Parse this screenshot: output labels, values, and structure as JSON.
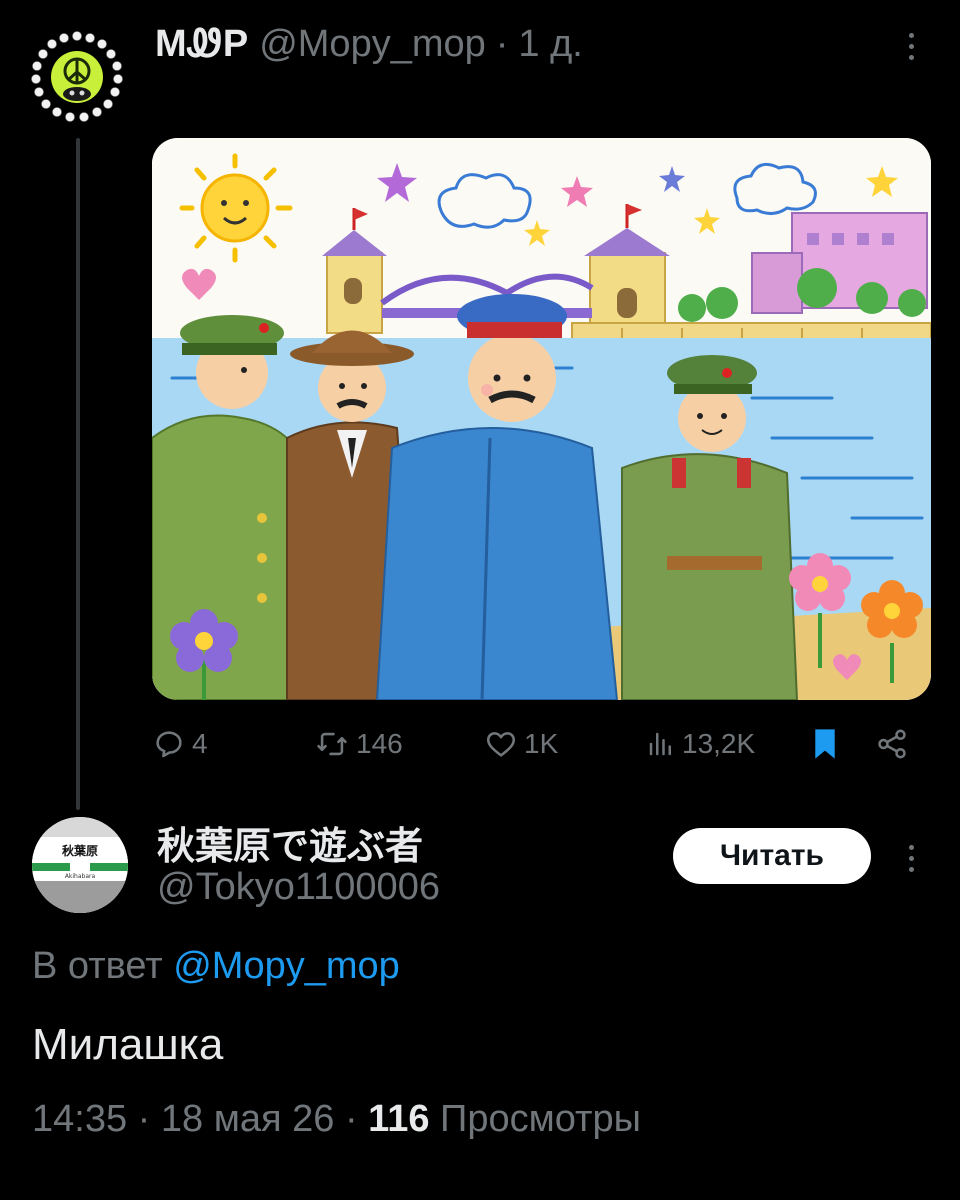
{
  "parent_tweet": {
    "author_name": "MᏪP",
    "handle": "@Mopy_mop",
    "separator": "·",
    "time": "1 д.",
    "avatar_icon": "pepe-bead-necklace-avatar",
    "image_description_icon": "crayon-drawing-four-men-by-river",
    "stats": {
      "replies": "4",
      "reposts": "146",
      "likes": "1K",
      "views": "13,2K"
    },
    "bookmark_active": true,
    "accent_color": "#1d9bf0"
  },
  "reply": {
    "author_name": "秋葉原で遊ぶ者",
    "handle": "@Tokyo1100006",
    "follow_label": "Читать",
    "avatar_icon": "akihabara-station-sign-avatar",
    "avatar_sign_text": "秋葉原",
    "avatar_sign_sub": "Akihabara",
    "reply_prefix": "В ответ",
    "reply_mention": "@Mopy_mop",
    "text": "Милашка",
    "time": "14:35",
    "date": "18 мая 26",
    "views_count": "116",
    "views_label": "Просмотры",
    "separator": "·"
  }
}
